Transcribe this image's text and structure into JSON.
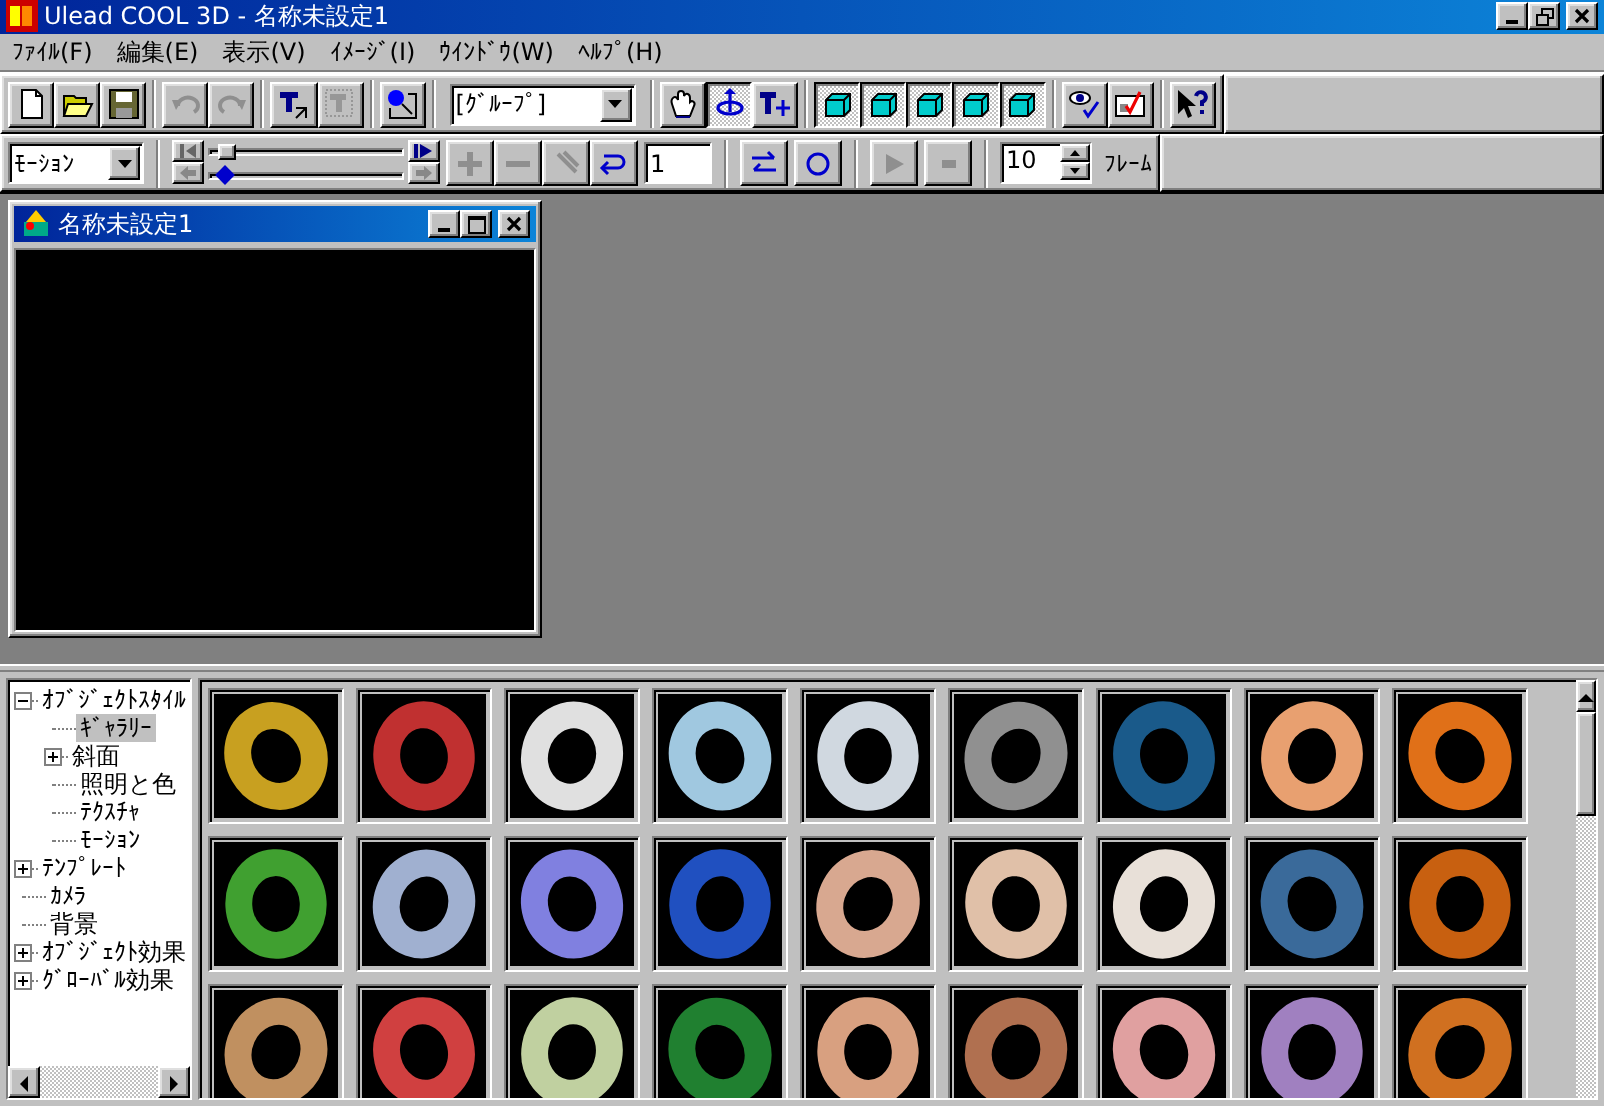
{
  "window": {
    "title": "Ulead COOL 3D - 名称未設定1"
  },
  "menu": [
    {
      "label": "ﾌｧｲﾙ(F)"
    },
    {
      "label": "編集(E)"
    },
    {
      "label": "表示(V)"
    },
    {
      "label": "ｲﾒｰｼﾞ(I)"
    },
    {
      "label": "ｳｲﾝﾄﾞｳ(W)"
    },
    {
      "label": "ﾍﾙﾌﾟ(H)"
    }
  ],
  "toolbar": [
    {
      "kind": "button",
      "disabled": false,
      "pressed": false
    },
    {
      "kind": "button",
      "disabled": false,
      "pressed": false
    },
    {
      "kind": "button",
      "disabled": false,
      "pressed": false
    },
    {
      "kind": "separator"
    },
    {
      "kind": "button",
      "disabled": true,
      "pressed": false
    },
    {
      "kind": "button",
      "disabled": true,
      "pressed": false
    },
    {
      "kind": "separator"
    },
    {
      "kind": "button",
      "disabled": false,
      "pressed": false
    },
    {
      "kind": "button",
      "disabled": true,
      "pressed": false
    },
    {
      "kind": "separator"
    },
    {
      "kind": "button",
      "disabled": false,
      "pressed": false
    },
    {
      "kind": "separator"
    },
    {
      "kind": "combo",
      "value": "[ｸﾞﾙｰﾌﾟ]"
    },
    {
      "kind": "separator"
    },
    {
      "kind": "button",
      "disabled": false,
      "pressed": false
    },
    {
      "kind": "button",
      "disabled": false,
      "pressed": true
    },
    {
      "kind": "button",
      "disabled": false,
      "pressed": false
    },
    {
      "kind": "separator"
    },
    {
      "kind": "button",
      "disabled": false,
      "pressed": true
    },
    {
      "kind": "button",
      "disabled": false,
      "pressed": true
    },
    {
      "kind": "button",
      "disabled": false,
      "pressed": true
    },
    {
      "kind": "button",
      "disabled": false,
      "pressed": true
    },
    {
      "kind": "button",
      "disabled": false,
      "pressed": true
    },
    {
      "kind": "separator"
    },
    {
      "kind": "button",
      "disabled": false,
      "pressed": false
    },
    {
      "kind": "button",
      "disabled": false,
      "pressed": false
    },
    {
      "kind": "separator"
    },
    {
      "kind": "button",
      "disabled": false,
      "pressed": false
    }
  ],
  "animation_bar": {
    "mode_combo": {
      "value": "ﾓｰｼｮﾝ"
    },
    "sliders": [
      {
        "level": 0.04
      },
      {
        "level": 0.04
      }
    ],
    "key_buttons": [
      {
        "disabled": true
      },
      {
        "disabled": true
      },
      {
        "disabled": true
      },
      {
        "disabled": false
      }
    ],
    "frame_field": {
      "value": "1"
    },
    "play_buttons": [
      {
        "disabled": false
      },
      {
        "disabled": false
      },
      {
        "disabled": true
      },
      {
        "disabled": true
      }
    ],
    "frames_spinner": {
      "value": "10"
    },
    "frames_label": "ﾌﾚｰﾑ"
  },
  "document_window": {
    "title": "名称未設定1"
  },
  "tree": [
    {
      "label": "ｵﾌﾞｼﾞｪｸﾄｽﾀｲﾙ",
      "expanded": true,
      "selected": false,
      "children": [
        {
          "label": "ｷﾞｬﾗﾘｰ",
          "selected": true
        },
        {
          "label": "斜面",
          "expanded": false,
          "selected": false
        },
        {
          "label": "照明と色",
          "selected": false
        },
        {
          "label": "ﾃｸｽﾁｬ",
          "selected": false
        },
        {
          "label": "ﾓｰｼｮﾝ",
          "selected": false
        }
      ]
    },
    {
      "label": "ﾃﾝﾌﾟﾚｰﾄ",
      "expanded": false,
      "selected": false
    },
    {
      "label": "ｶﾒﾗ",
      "selected": false
    },
    {
      "label": "背景",
      "selected": false
    },
    {
      "label": "ｵﾌﾞｼﾞｪｸﾄ効果",
      "expanded": false,
      "selected": false
    },
    {
      "label": "ｸﾞﾛｰﾊﾞﾙ効果",
      "expanded": false,
      "selected": false
    }
  ],
  "gallery": [
    {
      "color": "#c8a020"
    },
    {
      "color": "#c03030"
    },
    {
      "color": "#e0e0e0"
    },
    {
      "color": "#a0c8e0"
    },
    {
      "color": "#d0d8e0"
    },
    {
      "color": "#909090"
    },
    {
      "color": "#1a5a8a"
    },
    {
      "color": "#e8a070"
    },
    {
      "color": "#e07018"
    },
    {
      "color": "#40a030"
    },
    {
      "color": "#a0b0d0"
    },
    {
      "color": "#8080e0"
    },
    {
      "color": "#2050c0"
    },
    {
      "color": "#d8a890"
    },
    {
      "color": "#e0c0a8"
    },
    {
      "color": "#e8e0d8"
    },
    {
      "color": "#3a6a9a"
    },
    {
      "color": "#c86010"
    },
    {
      "color": "#c09060"
    },
    {
      "color": "#d04040"
    },
    {
      "color": "#c0d0a0"
    },
    {
      "color": "#208030"
    },
    {
      "color": "#d8a080"
    },
    {
      "color": "#b07050"
    },
    {
      "color": "#e0a0a0"
    },
    {
      "color": "#a080c0"
    },
    {
      "color": "#d07020"
    }
  ]
}
